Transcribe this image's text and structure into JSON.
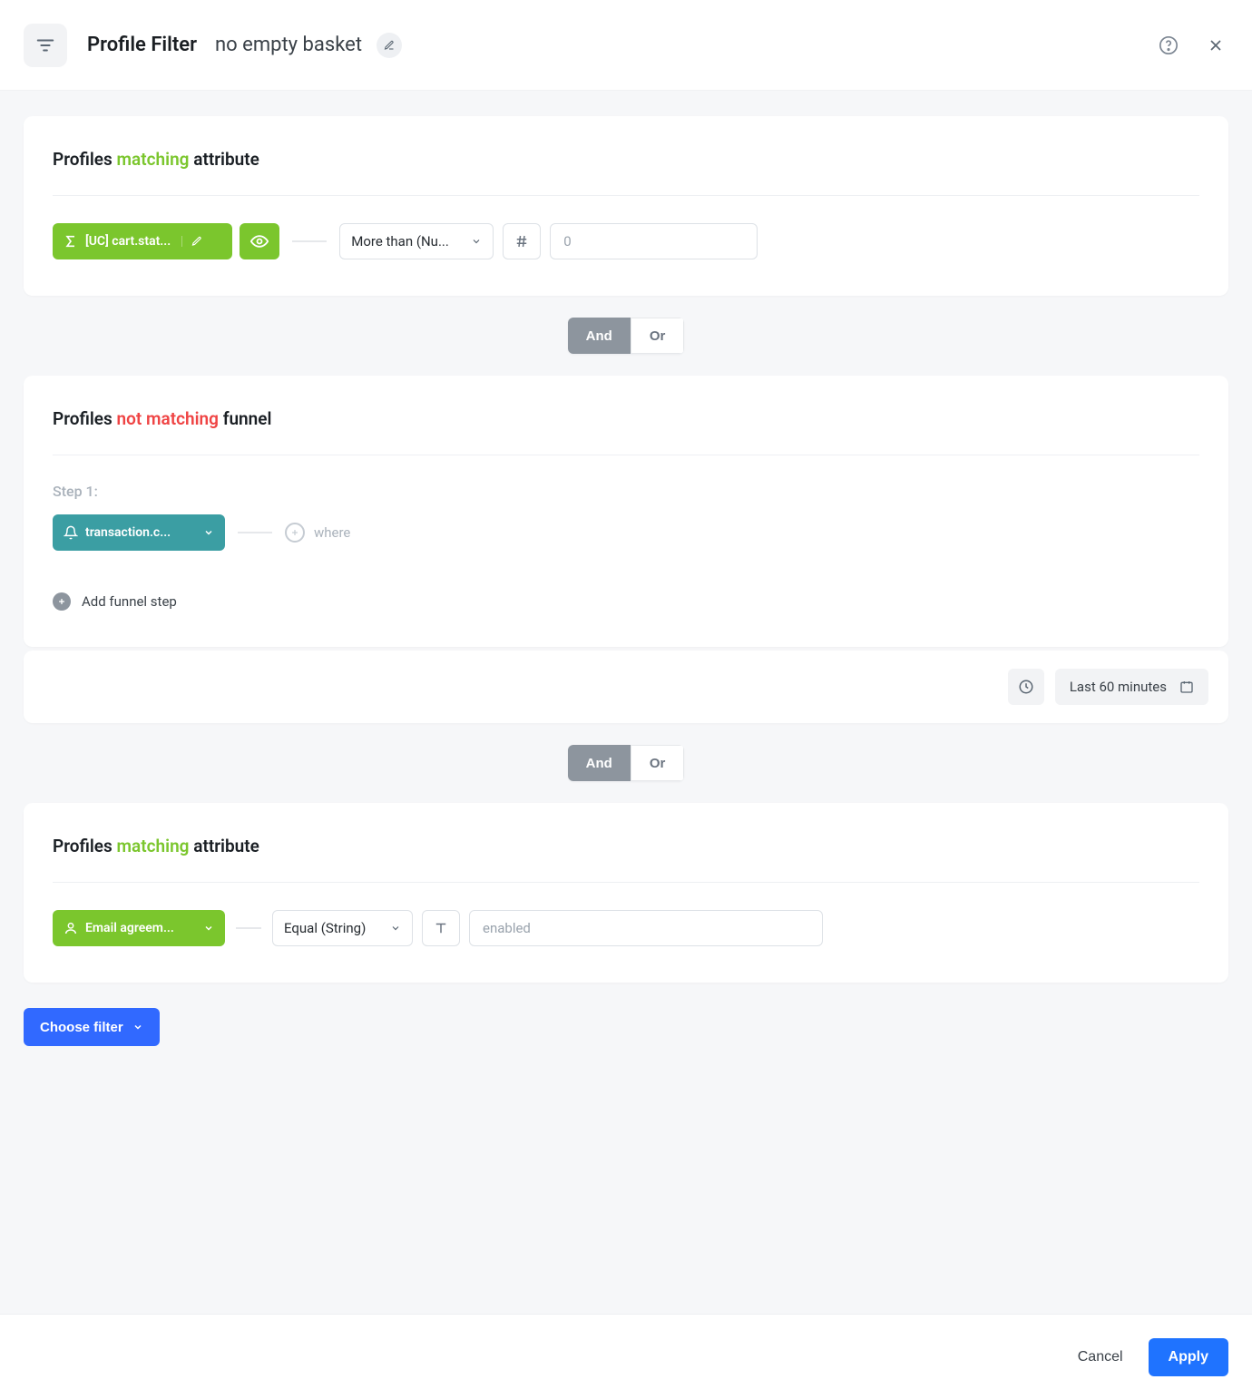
{
  "header": {
    "title": "Profile Filter",
    "name": "no empty basket"
  },
  "block1": {
    "prefix": "Profiles",
    "match_word": "matching",
    "suffix": "attribute",
    "chip_label": "[UC] cart.stat...",
    "operator": "More than (Nu...",
    "value_placeholder": "0",
    "value": ""
  },
  "andor1": {
    "and": "And",
    "or": "Or"
  },
  "block2": {
    "prefix": "Profiles",
    "match_word": "not matching",
    "suffix": "funnel",
    "step_label": "Step 1:",
    "chip_label": "transaction.c...",
    "where_label": "where",
    "add_step_label": "Add funnel step"
  },
  "time_row": {
    "range_label": "Last 60 minutes"
  },
  "andor2": {
    "and": "And",
    "or": "Or"
  },
  "block3": {
    "prefix": "Profiles",
    "match_word": "matching",
    "suffix": "attribute",
    "chip_label": "Email agreem...",
    "operator": "Equal (String)",
    "value_placeholder": "enabled",
    "value": ""
  },
  "choose_filter_label": "Choose filter",
  "footer": {
    "cancel": "Cancel",
    "apply": "Apply"
  }
}
